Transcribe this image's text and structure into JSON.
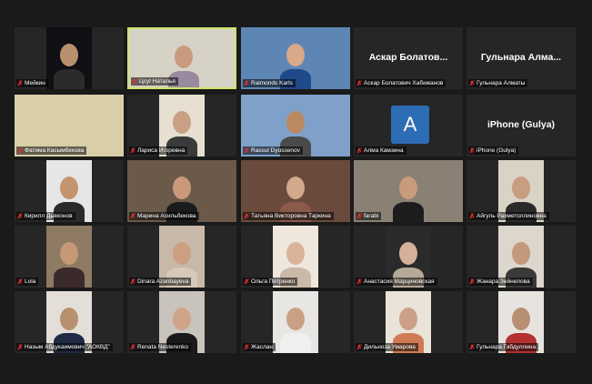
{
  "colors": {
    "background": "#1a1a1a",
    "tile_bg": "#262626",
    "active_speaker_border": "#cfe36b",
    "muted_icon": "#e0322f",
    "letter_avatar_bg": "#2d6db5"
  },
  "participants": [
    {
      "name": "Мейкин",
      "muted": true,
      "video": {
        "bg": "#0f0f14",
        "skin": "#b9906e",
        "cloth": "#2b2b2b",
        "wide": false
      }
    },
    {
      "name": "Цсуl Наталья",
      "muted": true,
      "active": true,
      "video": {
        "bg": "#d7d2c6",
        "skin": "#c99b7e",
        "cloth": "#9a8aa0",
        "wide": true
      }
    },
    {
      "name": "Raimonds Karls",
      "muted": true,
      "video": {
        "bg": "#5e86b4",
        "skin": "#d9a98a",
        "cloth": "#1f4a8a",
        "wide": true
      }
    },
    {
      "name": "Аскар Болатович Хабижанов",
      "muted": true,
      "display_name": "Аскар Болатов...",
      "video": null
    },
    {
      "name": "Гульнара Алматы",
      "muted": true,
      "display_name": "Гульнара Алма...",
      "video": null
    },
    {
      "name": "Фатима Касымбекова",
      "muted": true,
      "video": {
        "bg": "#d8cfa8",
        "skin": null,
        "cloth": null,
        "wide": true
      }
    },
    {
      "name": "Лариса Игоревна",
      "muted": true,
      "video": {
        "bg": "#e7dfcf",
        "skin": "#caa085",
        "cloth": "#3a3a3a",
        "wide": false
      }
    },
    {
      "name": "Rassul Dyussenov",
      "muted": true,
      "video": {
        "bg": "#7fa1c9",
        "skin": "#b98a62",
        "cloth": "#4a4a4a",
        "wide": true
      }
    },
    {
      "name": "Алма Камзина",
      "muted": true,
      "letter": "A",
      "video": null
    },
    {
      "name": "iPhone (Gulya)",
      "muted": true,
      "display_name": "iPhone (Gulya)",
      "video": null
    },
    {
      "name": "Кирилл Дьяконов",
      "muted": true,
      "video": {
        "bg": "#e6e6e6",
        "skin": "#c4946e",
        "cloth": "#2a2a2a",
        "wide": false
      }
    },
    {
      "name": "Марина Асильбекова",
      "muted": true,
      "video": {
        "bg": "#6b5a4a",
        "skin": "#c99a7a",
        "cloth": "#1b1b1b",
        "wide": true
      }
    },
    {
      "name": "Татьяна Викторовна Таркина",
      "muted": true,
      "video": {
        "bg": "#6a4a3c",
        "skin": "#d2a98c",
        "cloth": "#8a5a4a",
        "wide": true
      }
    },
    {
      "name": "farabi",
      "muted": true,
      "video": {
        "bg": "#8a8074",
        "skin": "#c89b7c",
        "cloth": "#1c1c1c",
        "wide": true
      }
    },
    {
      "name": "Айгуль Рахметоллиновна",
      "muted": true,
      "video": {
        "bg": "#d9d3c5",
        "skin": "#c99d80",
        "cloth": "#2a2a2a",
        "wide": false
      }
    },
    {
      "name": "Lola",
      "muted": true,
      "video": {
        "bg": "#8f7a64",
        "skin": "#c59876",
        "cloth": "#3a2a2a",
        "wide": false
      }
    },
    {
      "name": "Dinara Azanbayeva",
      "muted": true,
      "video": {
        "bg": "#c8b8a8",
        "skin": "#cd9f82",
        "cloth": "#d7c8b8",
        "wide": false
      }
    },
    {
      "name": "Ольга Петренко",
      "muted": true,
      "video": {
        "bg": "#efe7dc",
        "skin": "#d9b39a",
        "cloth": "#c9b9a9",
        "wide": false
      }
    },
    {
      "name": "Анастасия Марциновская",
      "muted": true,
      "video": {
        "bg": "#2a2a2a",
        "skin": "#d7b09a",
        "cloth": "#b7a898",
        "wide": false
      }
    },
    {
      "name": "Жанара Зейнелова",
      "muted": true,
      "video": {
        "bg": "#dcd6cc",
        "skin": "#c3987b",
        "cloth": "#3a3a3a",
        "wide": false
      }
    },
    {
      "name": "Назым Абдукаимович \"АОКВД\"",
      "muted": true,
      "video": {
        "bg": "#e3dfd8",
        "skin": "#b8906f",
        "cloth": "#1f2a44",
        "wide": false
      }
    },
    {
      "name": "Renata Nesterenko",
      "muted": true,
      "video": {
        "bg": "#c9c3bd",
        "skin": "#d0a489",
        "cloth": "#1a1a1a",
        "wide": false
      }
    },
    {
      "name": "Жаслан",
      "muted": true,
      "video": {
        "bg": "#e8e6e2",
        "skin": "#c9a083",
        "cloth": "#f0f0f0",
        "wide": false
      }
    },
    {
      "name": "Дильноза Умарова",
      "muted": true,
      "video": {
        "bg": "#e9e3d8",
        "skin": "#cba086",
        "cloth": "#d07a55",
        "wide": false
      }
    },
    {
      "name": "Гульнара Габдуллина",
      "muted": true,
      "video": {
        "bg": "#e7e4df",
        "skin": "#b88f73",
        "cloth": "#b33131",
        "wide": false
      }
    }
  ]
}
